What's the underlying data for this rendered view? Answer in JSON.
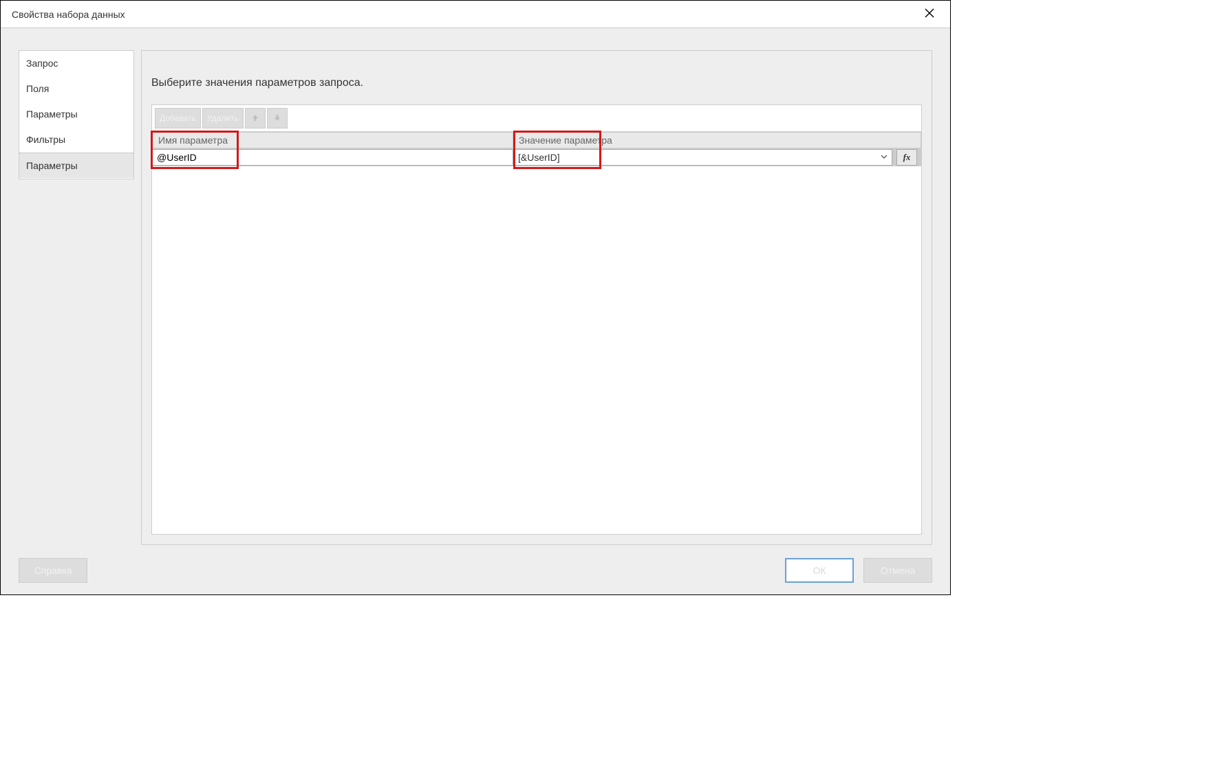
{
  "titlebar": {
    "title": "Свойства набора данных"
  },
  "sidebar": {
    "tabs": [
      {
        "label": "Запрос"
      },
      {
        "label": "Поля"
      },
      {
        "label": "Параметры"
      },
      {
        "label": "Фильтры"
      },
      {
        "label": "Параметры"
      }
    ],
    "selected_index": 4
  },
  "main": {
    "instruction": "Выберите значения параметров запроса.",
    "toolbar": {
      "add_label": "Добавить",
      "delete_label": "Удалить"
    },
    "grid": {
      "columns": {
        "name": "Имя параметра",
        "value": "Значение параметра"
      },
      "rows": [
        {
          "name": "@UserID",
          "value": "[&UserID]"
        }
      ]
    }
  },
  "footer": {
    "help_label": "Справка",
    "ok_label": "ОК",
    "cancel_label": "Отмена"
  }
}
